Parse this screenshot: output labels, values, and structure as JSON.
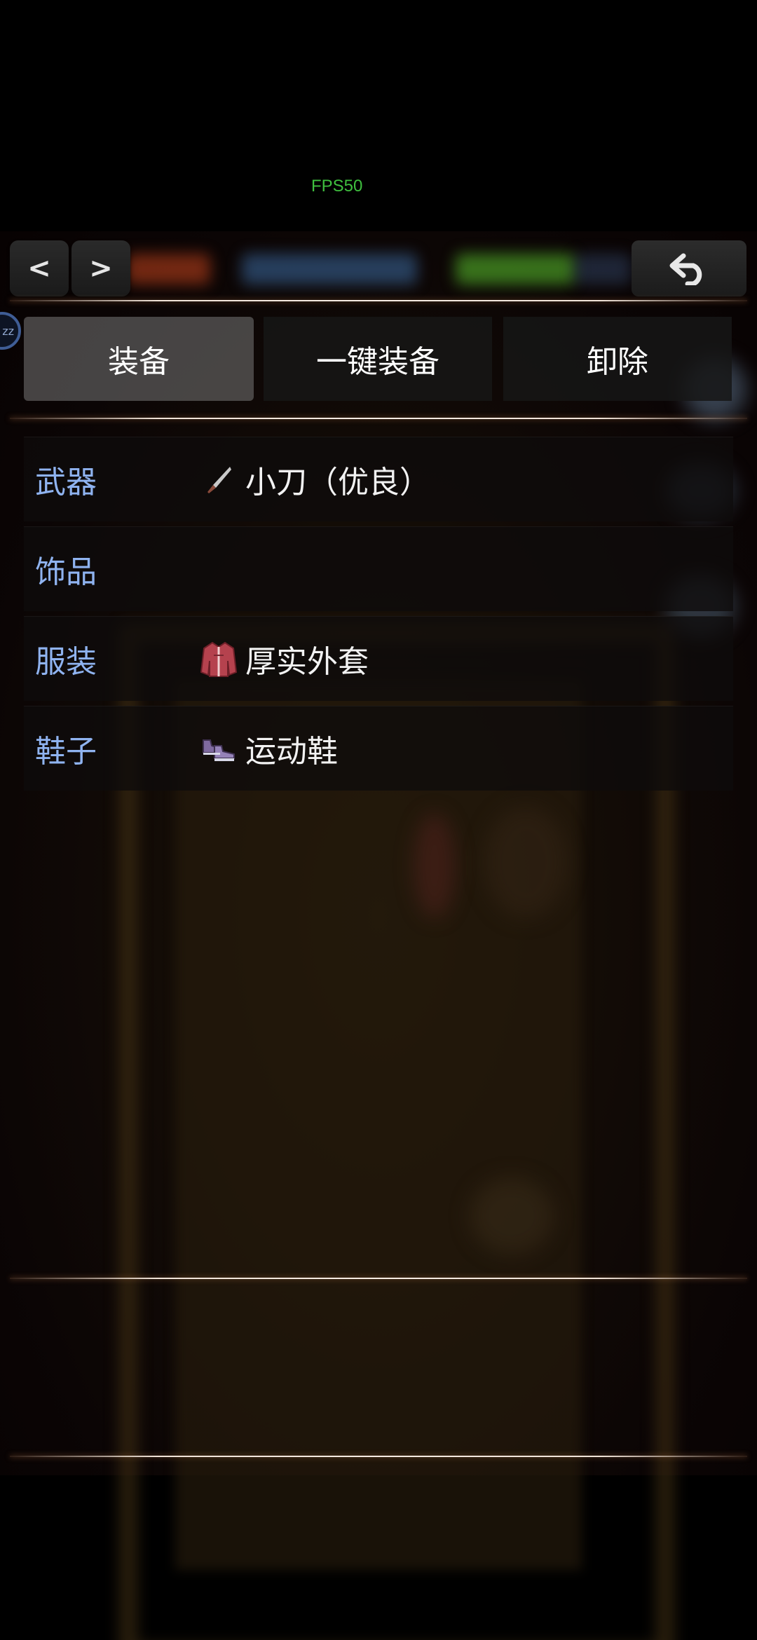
{
  "overlay": {
    "fps_text": "FPS50"
  },
  "nav": {
    "prev_label": "<",
    "next_label": ">",
    "back_icon": "undo-arrow-icon"
  },
  "tabs": [
    {
      "label": "装备",
      "active": true
    },
    {
      "label": "一键装备",
      "active": false
    },
    {
      "label": "卸除",
      "active": false
    }
  ],
  "slots": [
    {
      "label": "武器",
      "item": "小刀（优良）",
      "icon": "knife-icon"
    },
    {
      "label": "饰品",
      "item": "",
      "icon": ""
    },
    {
      "label": "服装",
      "item": "厚实外套",
      "icon": "jacket-icon"
    },
    {
      "label": "鞋子",
      "item": "运动鞋",
      "icon": "sneakers-icon"
    }
  ],
  "avatar": {
    "text": "zz"
  },
  "colors": {
    "slot_label": "#8fb3f0",
    "fps": "#3fbf3f",
    "active_tab": "#787878"
  }
}
